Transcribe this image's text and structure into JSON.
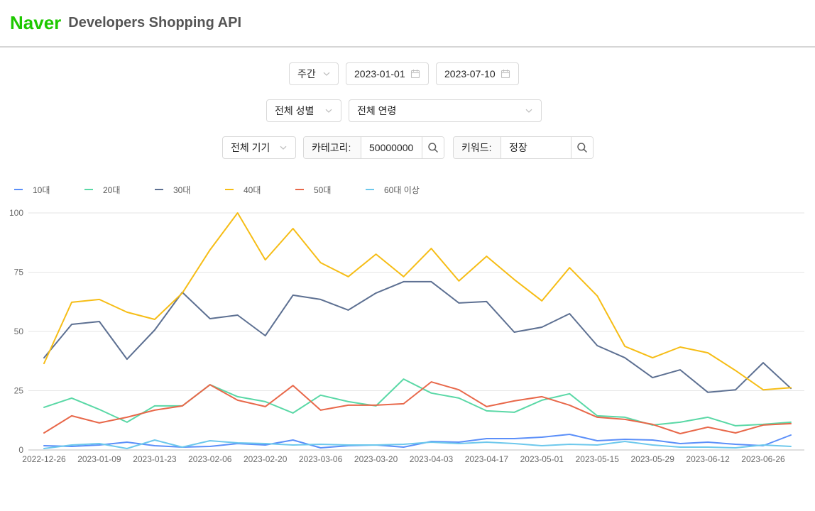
{
  "header": {
    "brand": "Naver",
    "brand_color": "#1ec800",
    "title": "Developers Shopping API"
  },
  "filters": {
    "period": {
      "value": "주간",
      "icon": "chevron-down-icon"
    },
    "start_date": {
      "value": "2023-01-01",
      "icon": "calendar-icon"
    },
    "end_date": {
      "value": "2023-07-10",
      "icon": "calendar-icon"
    },
    "gender": {
      "value": "전체 성별",
      "icon": "chevron-down-icon"
    },
    "age": {
      "value": "전체 연령",
      "icon": "chevron-down-icon"
    },
    "device": {
      "value": "전체 기기",
      "icon": "chevron-down-icon"
    },
    "category": {
      "label": "카테고리:",
      "value": "50000000",
      "icon": "search-icon"
    },
    "keyword": {
      "label": "키워드:",
      "value": "정장",
      "icon": "search-icon"
    }
  },
  "chart_data": {
    "type": "line",
    "x": [
      "2022-12-26",
      "2023-01-02",
      "2023-01-09",
      "2023-01-16",
      "2023-01-23",
      "2023-01-30",
      "2023-02-06",
      "2023-02-13",
      "2023-02-20",
      "2023-02-27",
      "2023-03-06",
      "2023-03-13",
      "2023-03-20",
      "2023-03-27",
      "2023-04-03",
      "2023-04-10",
      "2023-04-17",
      "2023-04-24",
      "2023-05-01",
      "2023-05-08",
      "2023-05-15",
      "2023-05-22",
      "2023-05-29",
      "2023-06-05",
      "2023-06-12",
      "2023-06-19",
      "2023-06-26",
      "2023-07-03"
    ],
    "xticks": [
      "2022-12-26",
      "2023-01-09",
      "2023-01-23",
      "2023-02-06",
      "2023-02-20",
      "2023-03-06",
      "2023-03-20",
      "2023-04-03",
      "2023-04-17",
      "2023-05-01",
      "2023-05-15",
      "2023-05-29",
      "2023-06-12",
      "2023-06-26"
    ],
    "yticks": [
      0,
      25,
      50,
      75,
      100
    ],
    "ylim": [
      0,
      100
    ],
    "grid": true,
    "legend": "top-left",
    "series": [
      {
        "name": "10대",
        "color": "#5b8ff9",
        "values": [
          1.8,
          1.5,
          2.1,
          3.3,
          1.8,
          1.2,
          1.5,
          2.7,
          2.1,
          4.2,
          0.9,
          1.8,
          2.1,
          1.2,
          3.6,
          3.3,
          4.8,
          4.8,
          5.4,
          6.6,
          3.9,
          4.5,
          4.2,
          2.7,
          3.3,
          2.4,
          1.8,
          6.3
        ]
      },
      {
        "name": "20대",
        "color": "#5ad8a6",
        "values": [
          18.0,
          21.9,
          17.1,
          11.7,
          18.6,
          18.6,
          27.5,
          22.5,
          20.4,
          15.6,
          23.1,
          20.4,
          18.6,
          29.9,
          24.0,
          21.9,
          16.5,
          15.9,
          21.0,
          23.7,
          14.4,
          13.8,
          10.5,
          11.7,
          13.8,
          10.2,
          10.8,
          11.7
        ]
      },
      {
        "name": "30대",
        "color": "#5d7092",
        "values": [
          38.9,
          53.0,
          54.2,
          38.3,
          50.6,
          66.5,
          55.4,
          56.9,
          48.2,
          65.3,
          63.5,
          59.0,
          66.2,
          71.0,
          71.0,
          62.0,
          62.6,
          49.7,
          51.8,
          57.5,
          44.0,
          38.9,
          30.5,
          33.8,
          24.3,
          25.4,
          36.8,
          26.0
        ]
      },
      {
        "name": "40대",
        "color": "#f6bd16",
        "values": [
          36.5,
          62.3,
          63.5,
          58.1,
          55.1,
          66.2,
          84.4,
          100,
          80.2,
          93.4,
          79.0,
          73.1,
          82.6,
          73.1,
          85.0,
          71.3,
          81.7,
          71.9,
          62.9,
          76.9,
          65.0,
          43.7,
          38.9,
          43.4,
          41.0,
          33.5,
          25.4,
          26.3
        ]
      },
      {
        "name": "50대",
        "color": "#e8684a",
        "values": [
          7.2,
          14.4,
          11.4,
          13.8,
          16.8,
          18.6,
          27.5,
          21.0,
          18.3,
          27.2,
          16.8,
          18.9,
          18.9,
          19.5,
          28.7,
          25.4,
          18.3,
          20.7,
          22.5,
          18.9,
          13.8,
          12.9,
          10.8,
          6.9,
          9.6,
          7.2,
          10.5,
          11.1
        ]
      },
      {
        "name": "60대 이상",
        "color": "#6dc8ec",
        "values": [
          0.6,
          2.1,
          2.7,
          0.6,
          4.2,
          1.2,
          3.9,
          3.0,
          2.7,
          2.1,
          2.4,
          2.1,
          2.1,
          2.4,
          3.3,
          2.7,
          3.3,
          2.7,
          1.8,
          2.4,
          2.1,
          3.6,
          2.1,
          1.2,
          1.2,
          0.9,
          2.1,
          1.5
        ]
      }
    ]
  }
}
